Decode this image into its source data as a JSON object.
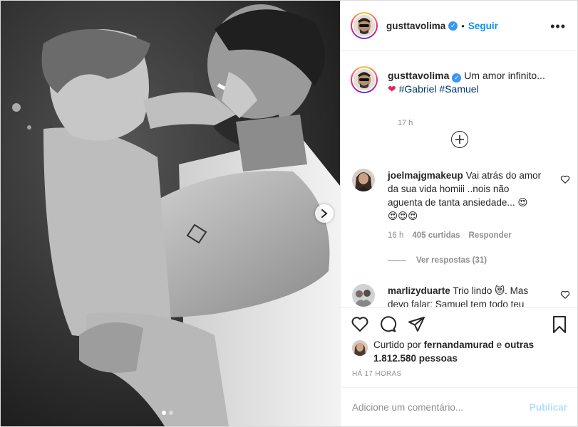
{
  "header": {
    "username": "gusttavolima",
    "separator": "•",
    "follow_label": "Seguir",
    "more_icon": "more-horizontal-icon"
  },
  "caption": {
    "username": "gusttavolima",
    "text": "Um amor infinito...",
    "heart": "❤",
    "tags": "#Gabriel #Samuel",
    "time": "17 h"
  },
  "comments": [
    {
      "username": "joelmajgmakeup",
      "text": "Vai atrás do amor da sua vida homiii ..nois não aguenta de tanta ansiedade...",
      "emoji_line1": "😍",
      "emoji_line2": "😍😍😍",
      "time": "16 h",
      "likes": "405 curtidas",
      "reply_label": "Responder",
      "view_replies": "Ver respostas (31)"
    },
    {
      "username": "marlizyduarte",
      "text": "Trio lindo 😻. Mas devo falar: Samuel tem todo teu"
    }
  ],
  "likes": {
    "prefix": "Curtido por",
    "user": "fernandamurad",
    "middle": "e",
    "others": "outras 1.812.580 pessoas"
  },
  "post_time": "HÁ 17 HORAS",
  "add_comment": {
    "placeholder": "Adicione um comentário...",
    "publish_label": "Publicar"
  },
  "colors": {
    "link": "#0095f6",
    "tag": "#00376b",
    "publish_disabled": "#b2dffc"
  },
  "carousel": {
    "current": 1,
    "total": 2
  }
}
